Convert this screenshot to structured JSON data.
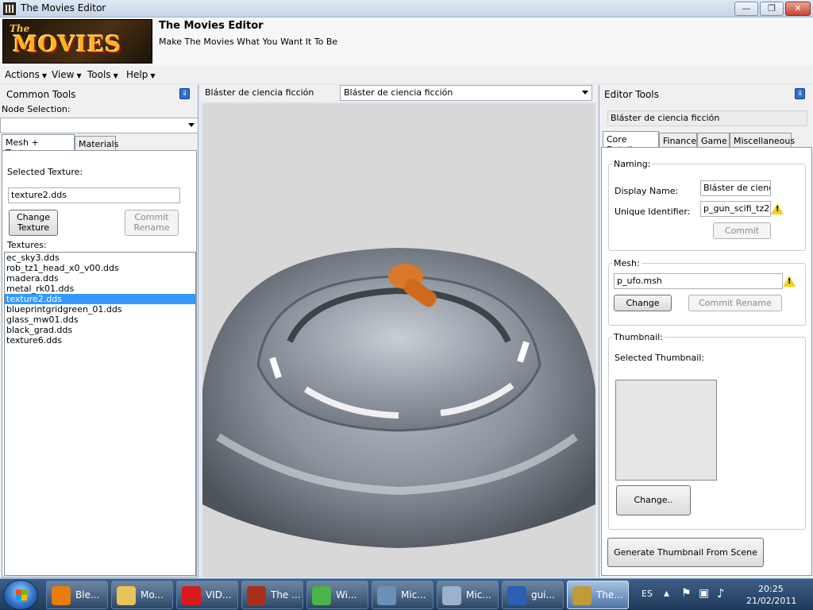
{
  "window": {
    "title": "The Movies Editor",
    "controls": {
      "minimize": "—",
      "maximize": "❐",
      "close": "✕"
    }
  },
  "header": {
    "logo_the": "The",
    "logo_movies": "MOVIES",
    "app_title": "The Movies Editor",
    "subtitle": "Make The Movies What You Want It To Be"
  },
  "menu": [
    {
      "label": "Actions"
    },
    {
      "label": "View"
    },
    {
      "label": "Tools"
    },
    {
      "label": "Help"
    }
  ],
  "left_panel": {
    "caption": "Common Tools",
    "node_selection_label": "Node Selection:",
    "node_selection_value": "",
    "tabs": [
      "Mesh + Textures",
      "Materials"
    ],
    "selected_texture_label": "Selected Texture:",
    "selected_texture_value": "texture2.dds",
    "change_texture_button": "Change Texture",
    "commit_rename_button": "Commit Rename",
    "textures_label": "Textures:",
    "textures": [
      "ec_sky3.dds",
      "rob_tz1_head_x0_v00.dds",
      "madera.dds",
      "metal_rk01.dds",
      "texture2.dds",
      "blueprintgridgreen_01.dds",
      "glass_mw01.dds",
      "black_grad.dds",
      "texture6.dds"
    ],
    "selected_index": 4
  },
  "center": {
    "object_name_label": "Bláster de ciencia ficción",
    "object_dropdown_value": "Bláster de ciencia ficción"
  },
  "right_panel": {
    "caption": "Editor Tools",
    "object_title": "Bláster de ciencia ficción",
    "tabs": [
      "Core Details",
      "Finance",
      "Game",
      "Miscellaneous"
    ],
    "naming": {
      "legend": "Naming:",
      "display_name_label": "Display Name:",
      "display_name_value": "Bláster de ciencia",
      "unique_id_label": "Unique Identifier:",
      "unique_id_value": "p_gun_scifi_tz2",
      "commit_button": "Commit"
    },
    "mesh": {
      "legend": "Mesh:",
      "value": "p_ufo.msh",
      "change_button": "Change",
      "commit_rename_button": "Commit Rename"
    },
    "thumbnail": {
      "legend": "Thumbnail:",
      "selected_label": "Selected Thumbnail:",
      "change_button": "Change.."
    },
    "generate_button": "Generate Thumbnail  From Scene"
  },
  "taskbar": {
    "items": [
      {
        "label": "Ble...",
        "icon": "blender-icon",
        "color": "#e87d0d"
      },
      {
        "label": "Mo...",
        "icon": "folder-icon",
        "color": "#e8c25a"
      },
      {
        "label": "VID...",
        "icon": "opera-icon",
        "color": "#d81a1a"
      },
      {
        "label": "The ...",
        "icon": "the-movies-icon",
        "color": "#a8301a"
      },
      {
        "label": "Wi...",
        "icon": "windows-live-icon",
        "color": "#4ab34a"
      },
      {
        "label": "Mic...",
        "icon": "computer-icon",
        "color": "#6a8fb8"
      },
      {
        "label": "Mic...",
        "icon": "media-center-icon",
        "color": "#9ab2cc"
      },
      {
        "label": "gui...",
        "icon": "word-doc-icon",
        "color": "#2b5fb4"
      },
      {
        "label": "The...",
        "icon": "the-movies-editor-icon",
        "color": "#c29a3a"
      }
    ],
    "active_index": 8,
    "language": "ES",
    "time": "20:25",
    "date": "21/02/2011"
  }
}
